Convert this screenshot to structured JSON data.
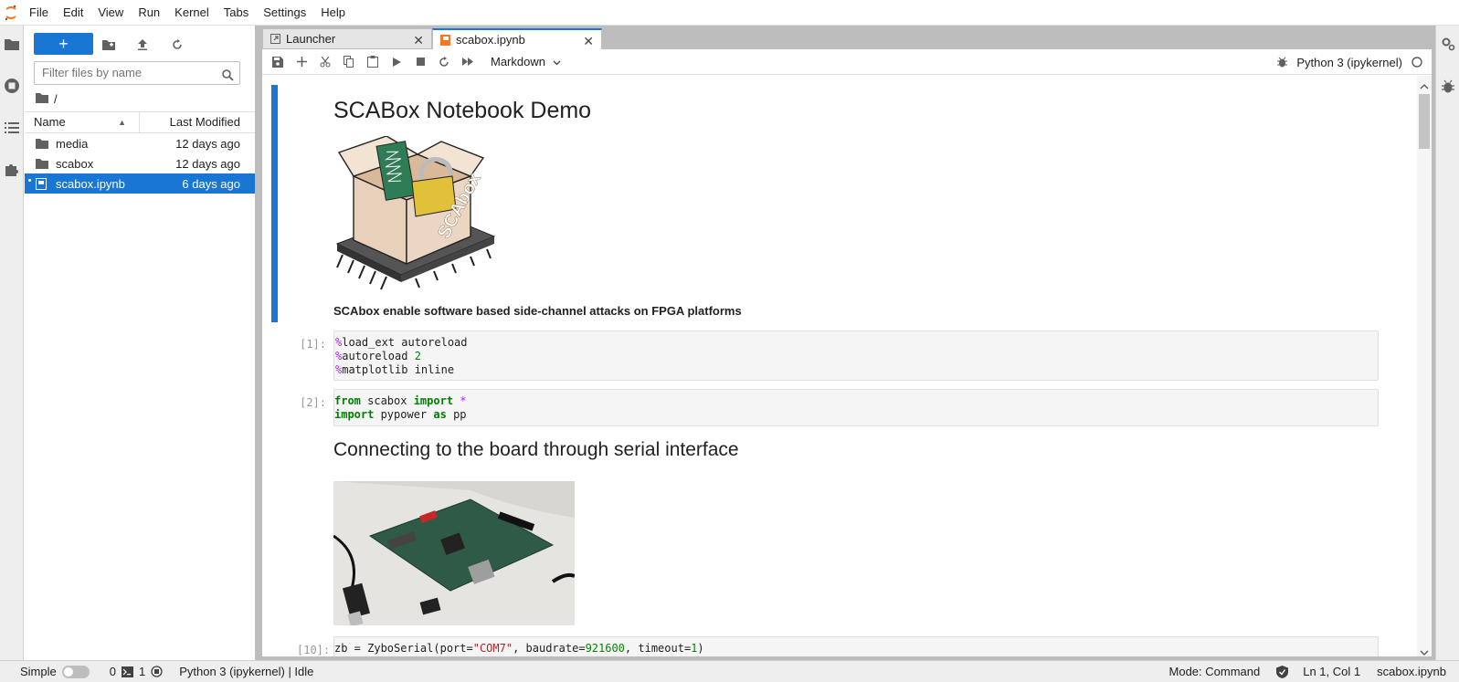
{
  "menubar": {
    "items": [
      "File",
      "Edit",
      "View",
      "Run",
      "Kernel",
      "Tabs",
      "Settings",
      "Help"
    ]
  },
  "filebrowser": {
    "new_label": "+",
    "filter_placeholder": "Filter files by name",
    "breadcrumb": "/",
    "columns": {
      "name": "Name",
      "modified": "Last Modified"
    },
    "items": [
      {
        "name": "media",
        "modified": "12 days ago",
        "kind": "folder",
        "selected": false
      },
      {
        "name": "scabox",
        "modified": "12 days ago",
        "kind": "folder",
        "selected": false
      },
      {
        "name": "scabox.ipynb",
        "modified": "6 days ago",
        "kind": "notebook",
        "selected": true
      }
    ]
  },
  "tabs": [
    {
      "label": "Launcher",
      "active": false
    },
    {
      "label": "scabox.ipynb",
      "active": true
    }
  ],
  "notebook_toolbar": {
    "cell_type": "Markdown",
    "kernel": "Python 3 (ipykernel)"
  },
  "notebook": {
    "heading1": "SCABox Notebook Demo",
    "logo_text": "SCAbox",
    "subtitle": "SCAbox enable software based side-channel attacks on FPGA platforms",
    "cell1": {
      "prompt": "[1]:",
      "lines": [
        {
          "magic": "%",
          "rest": "load_ext autoreload",
          "num": ""
        },
        {
          "magic": "%",
          "rest": "autoreload ",
          "num": "2"
        },
        {
          "magic": "%",
          "rest": "matplotlib inline",
          "num": ""
        }
      ]
    },
    "cell2": {
      "prompt": "[2]:",
      "line1": {
        "kw1": "from",
        "mid": " scabox ",
        "kw2": "import",
        "op": " *"
      },
      "line2": {
        "kw1": "import",
        "mid": " pypower ",
        "kw2": "as",
        "rest": " pp"
      }
    },
    "heading2": "Connecting to the board through serial interface",
    "cell3": {
      "prompt": "[10]:",
      "a": "zb = ZyboSerial(port=",
      "port": "\"COM7\"",
      "b": ", baudrate=",
      "baud": "921600",
      "c": ", timeout=",
      "to": "1",
      "d": ")"
    }
  },
  "statusbar": {
    "mode_label": "Simple",
    "terminals": "0",
    "kernels": "1",
    "kernel_status": "Python 3 (ipykernel) | Idle",
    "mode": "Mode: Command",
    "position": "Ln 1, Col 1",
    "filename": "scabox.ipynb"
  },
  "colors": {
    "accent": "#1976d2",
    "jupyter_orange": "#f37726"
  }
}
